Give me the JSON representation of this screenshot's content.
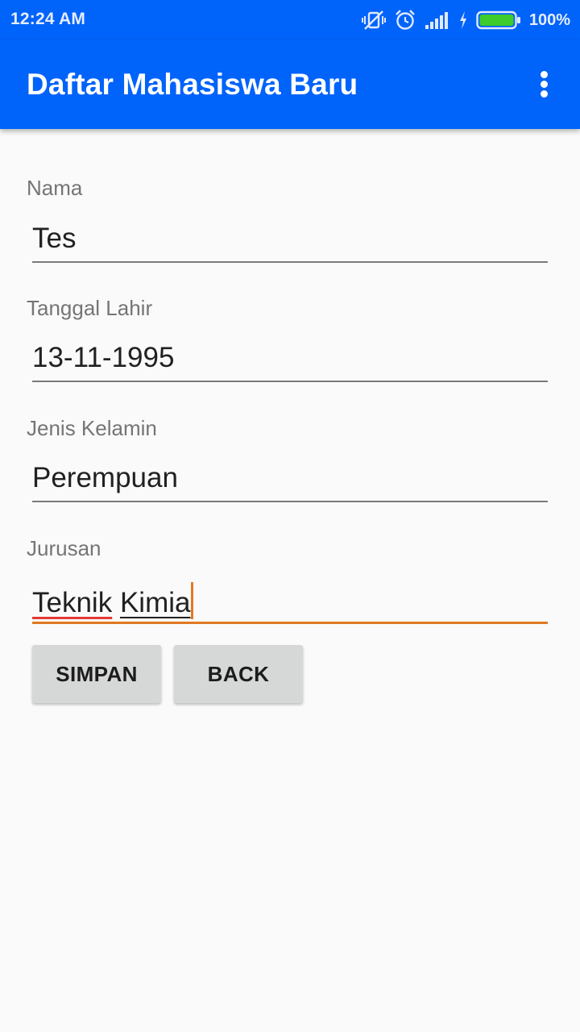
{
  "status_bar": {
    "time": "12:24 AM",
    "battery_percent": "100%",
    "icons": [
      "vibrate-off-icon",
      "alarm-icon",
      "signal-icon",
      "charging-icon",
      "battery-icon"
    ]
  },
  "app_bar": {
    "title": "Daftar Mahasiswa Baru",
    "menu_icon": "overflow-menu-icon"
  },
  "form": {
    "fields": [
      {
        "label": "Nama",
        "value": "Tes"
      },
      {
        "label": "Tanggal Lahir",
        "value": "13-11-1995"
      },
      {
        "label": "Jenis Kelamin",
        "value": "Perempuan"
      },
      {
        "label": "Jurusan",
        "value_word1": "Teknik",
        "value_word2": "Kimia",
        "value": "Teknik Kimia"
      }
    ],
    "buttons": {
      "save_label": "SIMPAN",
      "back_label": "BACK"
    }
  },
  "colors": {
    "primary": "#0063fa",
    "accent": "#e07a22",
    "background": "#fafafa",
    "button": "#d6d7d7",
    "spellcheck": "#e53935"
  }
}
